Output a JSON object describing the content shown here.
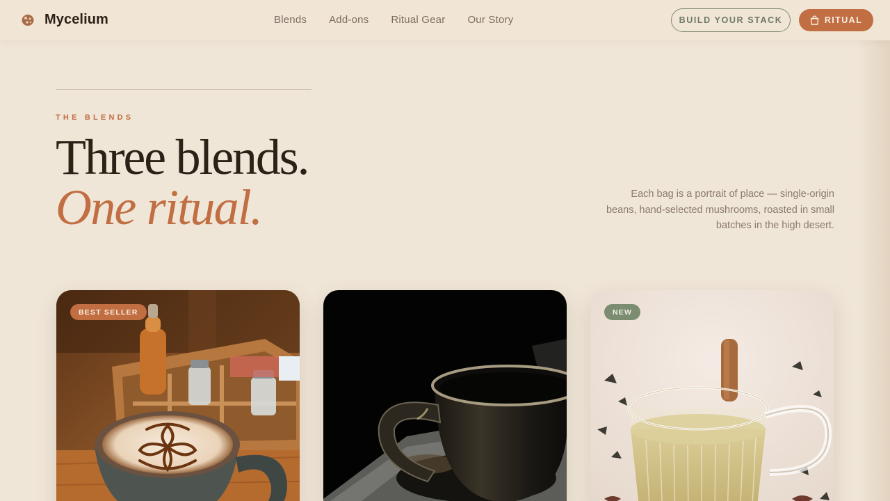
{
  "header": {
    "brand": "Mycelium",
    "logo_icon": "mushroom-icon",
    "nav": [
      "Blends",
      "Add-ons",
      "Ritual Gear",
      "Our Story"
    ],
    "cta_outline": "BUILD YOUR STACK",
    "cta_solid": "RITUAL",
    "cta_solid_icon": "shopping-bag-icon"
  },
  "hero": {
    "eyebrow": "THE BLENDS",
    "headline": "Three blends.",
    "subheadline": "One ritual.",
    "intro": "Each bag is a portrait of place — single-origin beans, hand-selected mushrooms, roasted in small batches in the high desert."
  },
  "cards": [
    {
      "badge": "BEST SELLER",
      "image": "latte-art-mug-photo"
    },
    {
      "badge": "",
      "image": "dark-ceramic-cup-photo"
    },
    {
      "badge": "NEW",
      "image": "glass-tea-cup-photo"
    }
  ],
  "colors": {
    "background": "#f0e6d8",
    "accent": "#c06e42",
    "sage": "#7c8c70",
    "text": "#2b2116",
    "muted": "#8a7a6c"
  }
}
